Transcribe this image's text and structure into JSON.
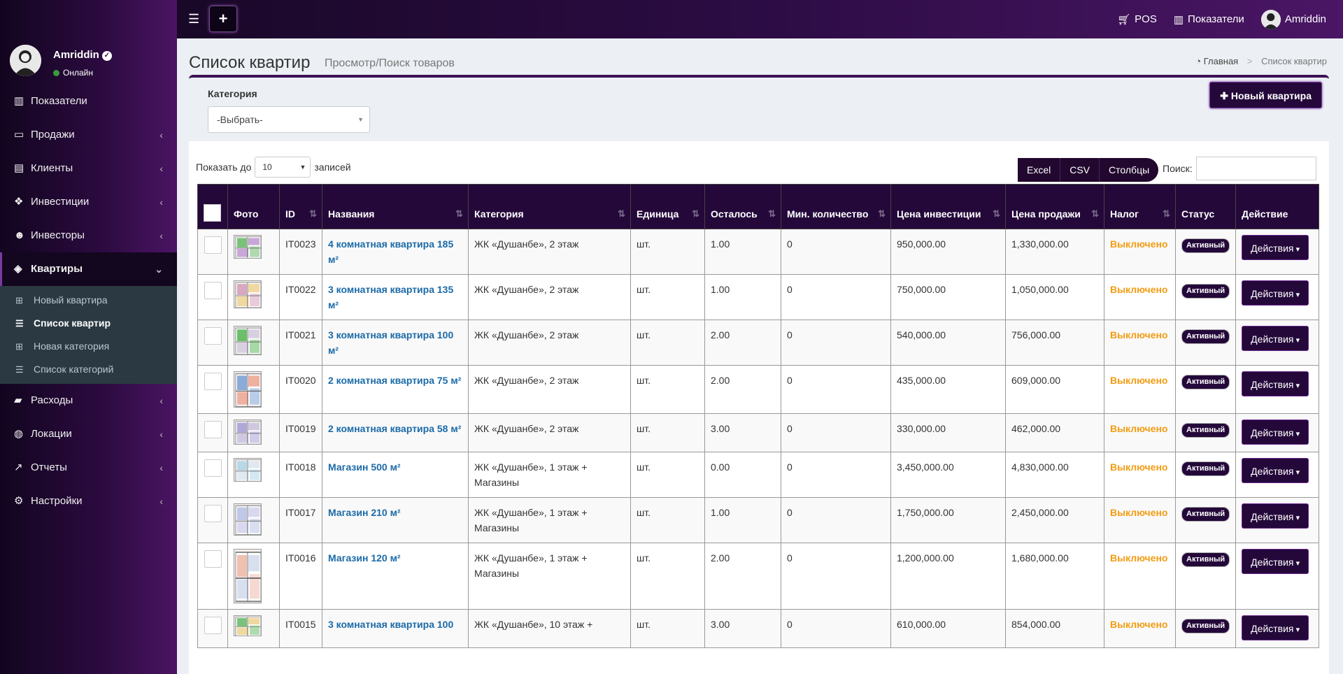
{
  "user": {
    "name": "Amriddin",
    "status": "Онлайн"
  },
  "sidebar": {
    "items": [
      {
        "label": "Показатели",
        "icon": "bar-chart-icon",
        "glyph": "▥",
        "chevron": false
      },
      {
        "label": "Продажи",
        "icon": "credit-card-icon",
        "glyph": "▭",
        "chevron": true
      },
      {
        "label": "Клиенты",
        "icon": "address-card-icon",
        "glyph": "▤",
        "chevron": true
      },
      {
        "label": "Инвестиции",
        "icon": "handshake-icon",
        "glyph": "❖",
        "chevron": true
      },
      {
        "label": "Инвесторы",
        "icon": "users-icon",
        "glyph": "☻",
        "chevron": true
      },
      {
        "label": "Квартиры",
        "icon": "cubes-icon",
        "glyph": "◈",
        "chevron": true,
        "active": true
      }
    ],
    "submenu": [
      {
        "label": "Новый квартира",
        "icon": "plus-square-icon",
        "glyph": "⊞"
      },
      {
        "label": "Список квартир",
        "icon": "list-icon",
        "glyph": "☰",
        "active": true
      },
      {
        "label": "Новая категория",
        "icon": "plus-square-icon",
        "glyph": "⊞"
      },
      {
        "label": "Список категорий",
        "icon": "list-icon",
        "glyph": "☰"
      }
    ],
    "items2": [
      {
        "label": "Расходы",
        "icon": "wallet-icon",
        "glyph": "▰",
        "chevron": true
      },
      {
        "label": "Локации",
        "icon": "globe-icon",
        "glyph": "◍",
        "chevron": true
      },
      {
        "label": "Отчеты",
        "icon": "line-chart-icon",
        "glyph": "↗",
        "chevron": true
      },
      {
        "label": "Настройки",
        "icon": "cogs-icon",
        "glyph": "⚙",
        "chevron": true
      }
    ]
  },
  "topbar": {
    "pos": "POS",
    "dashboard": "Показатели",
    "user": "Amriddin"
  },
  "header": {
    "title": "Список квартир",
    "subtitle": "Просмотр/Поиск товаров"
  },
  "breadcrumb": {
    "home": "Главная",
    "current": "Список квартир"
  },
  "filter": {
    "category_label": "Категория",
    "category_value": "-Выбрать-",
    "new_button": "Новый квартира"
  },
  "table_controls": {
    "show_prefix": "Показать до",
    "page_size": "10",
    "show_suffix": "записей",
    "buttons": [
      "Excel",
      "CSV",
      "Столбцы"
    ],
    "search_label": "Поиск:"
  },
  "columns": [
    "Фото",
    "ID",
    "Названия",
    "Категория",
    "Единица",
    "Осталось",
    "Мин. количество",
    "Цена инвестиции",
    "Цена продажи",
    "Налог",
    "Статус",
    "Действие"
  ],
  "rows": [
    {
      "id": "IT0023",
      "name": "4 комнатная квартира 185 м²",
      "category": "ЖК «Душанбе», 2 этаж",
      "unit": "шт.",
      "left": "1.00",
      "min": "0",
      "invest": "950,000.00",
      "sale": "1,330,000.00",
      "tax": "Выключено",
      "status": "Активный",
      "action": "Действия"
    },
    {
      "id": "IT0022",
      "name": "3 комнатная квартира 135 м²",
      "category": "ЖК «Душанбе», 2 этаж",
      "unit": "шт.",
      "left": "1.00",
      "min": "0",
      "invest": "750,000.00",
      "sale": "1,050,000.00",
      "tax": "Выключено",
      "status": "Активный",
      "action": "Действия"
    },
    {
      "id": "IT0021",
      "name": "3 комнатная квартира 100 м²",
      "category": "ЖК «Душанбе», 2 этаж",
      "unit": "шт.",
      "left": "2.00",
      "min": "0",
      "invest": "540,000.00",
      "sale": "756,000.00",
      "tax": "Выключено",
      "status": "Активный",
      "action": "Действия"
    },
    {
      "id": "IT0020",
      "name": "2 комнатная квартира 75 м²",
      "category": "ЖК «Душанбе», 2 этаж",
      "unit": "шт.",
      "left": "2.00",
      "min": "0",
      "invest": "435,000.00",
      "sale": "609,000.00",
      "tax": "Выключено",
      "status": "Активный",
      "action": "Действия"
    },
    {
      "id": "IT0019",
      "name": "2 комнатная квартира 58 м²",
      "category": "ЖК «Душанбе», 2 этаж",
      "unit": "шт.",
      "left": "3.00",
      "min": "0",
      "invest": "330,000.00",
      "sale": "462,000.00",
      "tax": "Выключено",
      "status": "Активный",
      "action": "Действия"
    },
    {
      "id": "IT0018",
      "name": "Магазин 500 м²",
      "category": "ЖК «Душанбе», 1 этаж + Магазины",
      "unit": "шт.",
      "left": "0.00",
      "min": "0",
      "invest": "3,450,000.00",
      "sale": "4,830,000.00",
      "tax": "Выключено",
      "status": "Активный",
      "action": "Действия"
    },
    {
      "id": "IT0017",
      "name": "Магазин 210 м²",
      "category": "ЖК «Душанбе», 1 этаж + Магазины",
      "unit": "шт.",
      "left": "1.00",
      "min": "0",
      "invest": "1,750,000.00",
      "sale": "2,450,000.00",
      "tax": "Выключено",
      "status": "Активный",
      "action": "Действия"
    },
    {
      "id": "IT0016",
      "name": "Магазин 120 м²",
      "category": "ЖК «Душанбе», 1 этаж + Магазины",
      "unit": "шт.",
      "left": "2.00",
      "min": "0",
      "invest": "1,200,000.00",
      "sale": "1,680,000.00",
      "tax": "Выключено",
      "status": "Активный",
      "action": "Действия"
    },
    {
      "id": "IT0015",
      "name": "3 комнатная квартира 100",
      "category": "ЖК «Душанбе», 10 этаж +",
      "unit": "шт.",
      "left": "3.00",
      "min": "0",
      "invest": "610,000.00",
      "sale": "854,000.00",
      "tax": "Выключено",
      "status": "Активный",
      "action": "Действия"
    }
  ],
  "colors": {
    "accent": "#24083a",
    "link": "#1a6aa8",
    "tax": "#f39c12",
    "online": "#3c9a3c"
  }
}
